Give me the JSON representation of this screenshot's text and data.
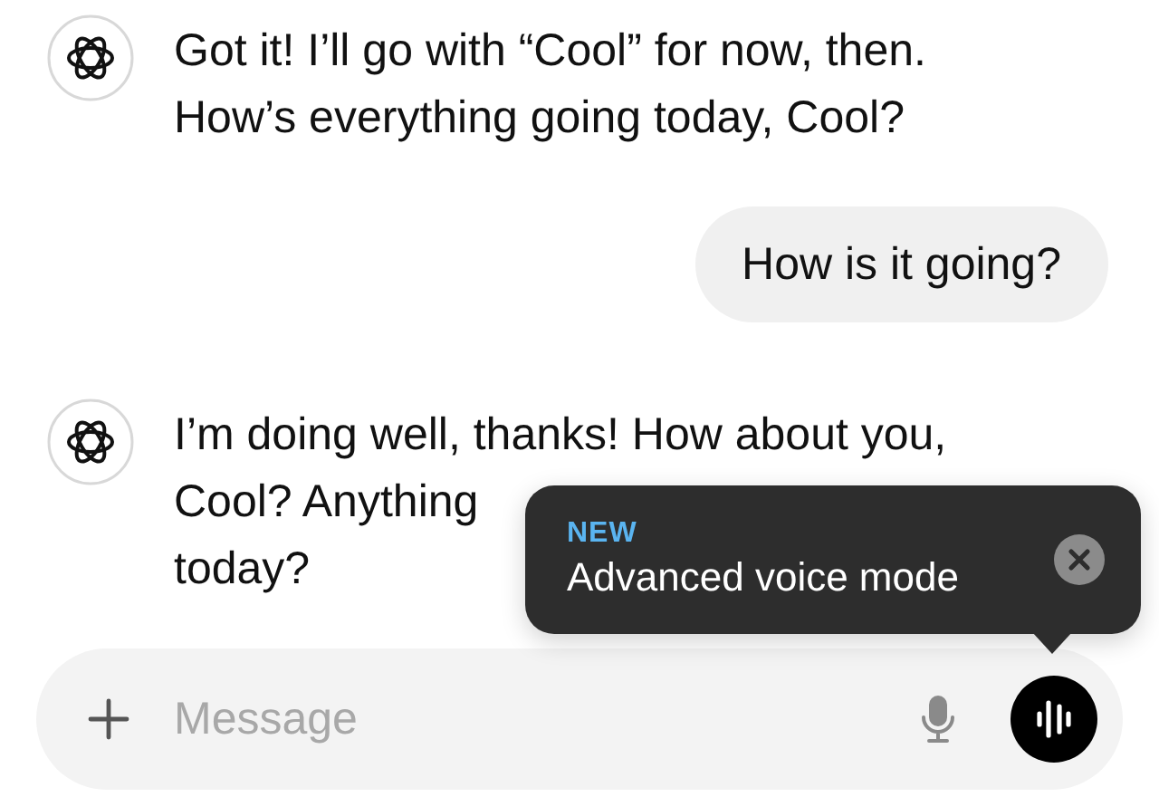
{
  "messages": [
    {
      "kind": "assistant",
      "lines": [
        "Got it! I’ll go with “Cool” for now, then.",
        "How’s everything going today, Cool?"
      ]
    },
    {
      "kind": "user",
      "lines": [
        "How is it going?"
      ]
    },
    {
      "kind": "assistant",
      "lines": [
        "I’m doing well, thanks! How about you,",
        "Cool? Anything",
        "today?"
      ]
    }
  ],
  "tooltip": {
    "badge": "NEW",
    "text": "Advanced voice mode"
  },
  "composer": {
    "placeholder": "Message"
  }
}
